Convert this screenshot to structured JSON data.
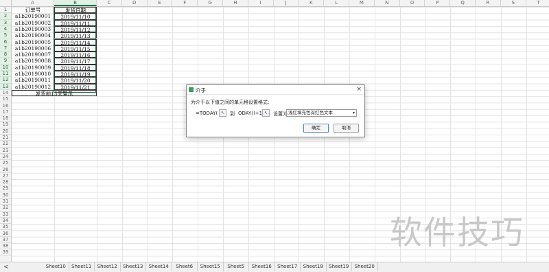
{
  "columns": [
    "A",
    "B",
    "C",
    "D",
    "E",
    "F",
    "G",
    "H",
    "I",
    "J",
    "K",
    "L",
    "M",
    "N",
    "O",
    "P",
    "Q",
    "R",
    "S",
    "T"
  ],
  "selected_column": "B",
  "rows": [
    "1",
    "2",
    "3",
    "4",
    "5",
    "6",
    "7",
    "8",
    "9",
    "10",
    "11",
    "12",
    "13",
    "14",
    "15",
    "16",
    "17",
    "18",
    "19",
    "20",
    "21",
    "22",
    "23",
    "24",
    "25",
    "26",
    "27",
    "28",
    "29",
    "30",
    "31",
    "32",
    "33",
    "34",
    "35",
    "36",
    "37",
    "38",
    "39"
  ],
  "table": {
    "header": {
      "order": "订单号",
      "date": "发货日期"
    },
    "records": [
      {
        "order": "a1b20190001",
        "date": "2019/11/10"
      },
      {
        "order": "a1b20190002",
        "date": "2019/11/11"
      },
      {
        "order": "a1b20190003",
        "date": "2019/11/12"
      },
      {
        "order": "a1b20190004",
        "date": "2019/11/13"
      },
      {
        "order": "a1b20190005",
        "date": "2019/11/14"
      },
      {
        "order": "a1b20190006",
        "date": "2019/11/15"
      },
      {
        "order": "a1b20190007",
        "date": "2019/11/16"
      },
      {
        "order": "a1b20190008",
        "date": "2019/11/17"
      },
      {
        "order": "a1b20190009",
        "date": "2019/11/18"
      },
      {
        "order": "a1b20190010",
        "date": "2019/11/19"
      },
      {
        "order": "a1b20190011",
        "date": "2019/11/20"
      },
      {
        "order": "a1b20190012",
        "date": "2019/11/21"
      }
    ],
    "footer": "发货前15天警示"
  },
  "dialog": {
    "title": "介于",
    "prompt": "为介于以下值之间的单元格设置格式:",
    "value1": "=TODAY()",
    "to_label": "到",
    "value2": "ODAY()+15",
    "set_label": "设置为",
    "format_option": "浅红填充色深红色文本",
    "ok_label": "确定",
    "cancel_label": "取消",
    "icon": "app-icon",
    "close_icon": "×"
  },
  "tabs": {
    "nav_prev": "<",
    "items": [
      "Sheet10",
      "Sheet11",
      "Sheet12",
      "Sheet13",
      "Sheet14",
      "Sheet6",
      "Sheet15",
      "Sheet5",
      "Sheet16",
      "Sheet17",
      "Sheet18",
      "Sheet19",
      "Sheet20"
    ]
  },
  "watermark": "软件技巧",
  "colors": {
    "accent": "#217346",
    "dialog_icon": "#3aa05a"
  }
}
